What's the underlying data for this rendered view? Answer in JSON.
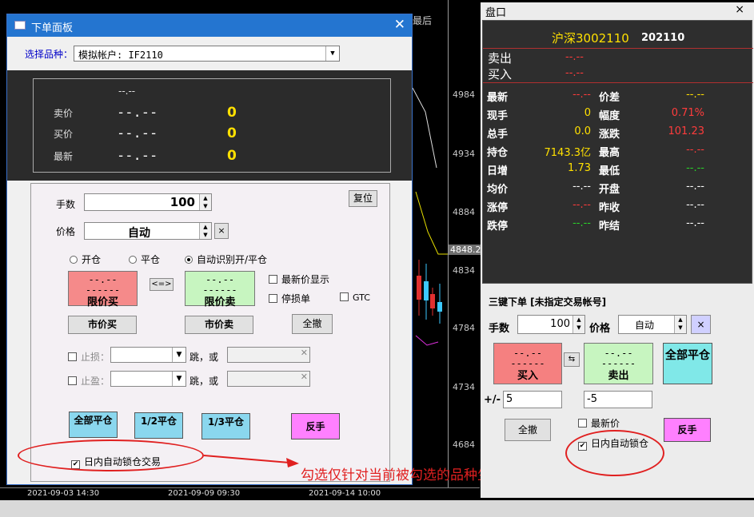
{
  "chart": {
    "price_ticks": [
      "4984",
      "4934",
      "4884",
      "4848.2",
      "4834",
      "4784",
      "4734",
      "4684"
    ],
    "time_ticks": [
      "2021-09-03 14:30",
      "2021-09-09 09:30",
      "2021-09-14 10:00"
    ],
    "top_label": "最后"
  },
  "order_dialog": {
    "title": "下单面板",
    "select_label": "选择品种：",
    "select_value": "模拟帐户: IF2110",
    "quote": {
      "header": "--.--",
      "rows": [
        {
          "label": "卖价",
          "price": "--.--",
          "qty": "0"
        },
        {
          "label": "买价",
          "price": "--.--",
          "qty": "0"
        },
        {
          "label": "最新",
          "price": "--.--",
          "qty": "0"
        }
      ]
    },
    "qty_label": "手数",
    "qty_value": "100",
    "reset_label": "复位",
    "price_label": "价格",
    "price_value": "自动",
    "clear_x": "×",
    "radios": [
      "开仓",
      "平仓",
      "自动识别开/平仓"
    ],
    "buy_limit": {
      "price": "--.--",
      "dash": "------",
      "label": "限价买"
    },
    "swap": "<=>",
    "sell_limit": {
      "price": "--.--",
      "dash": "------",
      "label": "限价卖"
    },
    "show_last_price": "最新价显示",
    "stop_order": "停损单",
    "gtc": "GTC",
    "market_buy": "市价买",
    "market_sell": "市价卖",
    "cancel_all": "全撤",
    "stop_loss": "止损：",
    "take_profit": "止盈：",
    "tick_or": "跳，或",
    "close_all": "全部平仓",
    "close_half": "1/2平仓",
    "close_third": "1/3平仓",
    "reverse": "反手",
    "auto_lock": "日内自动锁仓交易"
  },
  "annotation": "勾选仅针对当前被勾选的品种生效",
  "market_panel": {
    "title": "盘口",
    "close": "×",
    "symbol": "沪深3002110",
    "contract": "202110",
    "sell_label": "卖出",
    "sell_value": "--.--",
    "buy_label": "买入",
    "buy_value": "--.--",
    "left_rows": [
      {
        "label": "最新",
        "value": "--.--",
        "color": "red"
      },
      {
        "label": "现手",
        "value": "0",
        "color": "yellow"
      },
      {
        "label": "总手",
        "value": "0.0",
        "color": "yellow"
      },
      {
        "label": "持仓",
        "value": "7143.3亿",
        "color": "yellow"
      },
      {
        "label": "日增",
        "value": "1.73",
        "color": "yellow"
      },
      {
        "label": "均价",
        "value": "--.--",
        "color": "white"
      },
      {
        "label": "涨停",
        "value": "--.--",
        "color": "red"
      },
      {
        "label": "跌停",
        "value": "--.--",
        "color": "green"
      }
    ],
    "right_rows": [
      {
        "label": "价差",
        "value": "--.--",
        "color": "yellow"
      },
      {
        "label": "幅度",
        "value": "0.71%",
        "color": "red"
      },
      {
        "label": "涨跌",
        "value": "101.23",
        "color": "red"
      },
      {
        "label": "最高",
        "value": "--.--",
        "color": "red"
      },
      {
        "label": "最低",
        "value": "--.--",
        "color": "green"
      },
      {
        "label": "开盘",
        "value": "--.--",
        "color": "white"
      },
      {
        "label": "昨收",
        "value": "--.--",
        "color": "white"
      },
      {
        "label": "昨结",
        "value": "--.--",
        "color": "white"
      }
    ],
    "three_key_title": "三键下单 [未指定交易帐号]",
    "qty_label": "手数",
    "qty_value": "100",
    "price_label": "价格",
    "price_value": "自动",
    "clear_x": "×",
    "buy": {
      "price": "--.--",
      "dash": "------",
      "label": "买入"
    },
    "sell": {
      "price": "--.--",
      "dash": "------",
      "label": "卖出"
    },
    "close_all": "全部平仓",
    "swap": "⇆",
    "plus_minus": "+/-",
    "plus_value": "5",
    "minus_value": "-5",
    "cancel_all": "全撤",
    "last_price": "最新价",
    "auto_lock": "日内自动锁仓",
    "reverse": "反手"
  }
}
